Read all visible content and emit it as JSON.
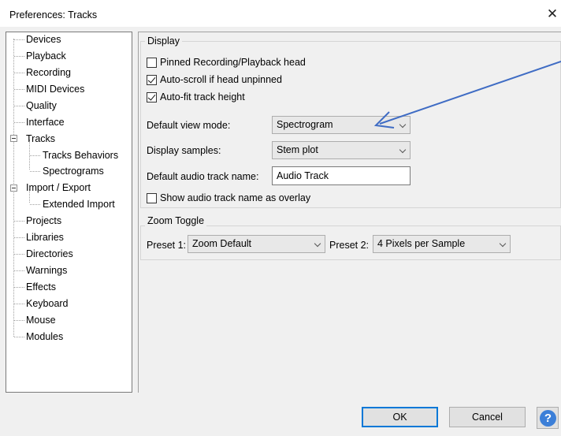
{
  "window": {
    "title": "Preferences: Tracks",
    "close_glyph": "✕"
  },
  "tree": {
    "items": [
      {
        "label": "Devices"
      },
      {
        "label": "Playback"
      },
      {
        "label": "Recording"
      },
      {
        "label": "MIDI Devices"
      },
      {
        "label": "Quality"
      },
      {
        "label": "Interface"
      },
      {
        "label": "Tracks"
      },
      {
        "label": "Tracks Behaviors"
      },
      {
        "label": "Spectrograms"
      },
      {
        "label": "Import / Export"
      },
      {
        "label": "Extended Import"
      },
      {
        "label": "Projects"
      },
      {
        "label": "Libraries"
      },
      {
        "label": "Directories"
      },
      {
        "label": "Warnings"
      },
      {
        "label": "Effects"
      },
      {
        "label": "Keyboard"
      },
      {
        "label": "Mouse"
      },
      {
        "label": "Modules"
      }
    ]
  },
  "display": {
    "title": "Display",
    "pinned_label": "Pinned Recording/Playback head",
    "pinned_checked": false,
    "autoscroll_label": "Auto-scroll if head unpinned",
    "autoscroll_checked": true,
    "autofit_label": "Auto-fit track height",
    "autofit_checked": true,
    "view_mode_label": "Default view mode:",
    "view_mode_value": "Spectrogram",
    "samples_label": "Display samples:",
    "samples_value": "Stem plot",
    "track_name_label": "Default audio track name:",
    "track_name_value": "Audio Track",
    "overlay_label": "Show audio track name as overlay",
    "overlay_checked": false
  },
  "zoom": {
    "title": "Zoom Toggle",
    "preset1_label": "Preset 1:",
    "preset1_value": "Zoom Default",
    "preset2_label": "Preset 2:",
    "preset2_value": "4 Pixels per Sample"
  },
  "buttons": {
    "ok": "OK",
    "cancel": "Cancel",
    "help": "?"
  },
  "colors": {
    "annotation_arrow": "#3f6cc4",
    "default_button_border": "#0078d7"
  }
}
